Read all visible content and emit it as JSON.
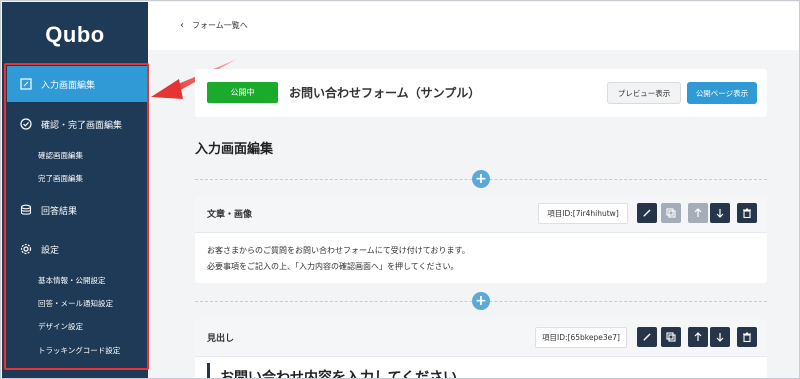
{
  "app": {
    "logo": "Qubo"
  },
  "sidebar": {
    "items": [
      {
        "label": "入力画面編集",
        "icon": "edit-icon",
        "active": true
      },
      {
        "label": "確認・完了画面編集",
        "icon": "check-circle-icon"
      },
      {
        "label": "回答結果",
        "icon": "database-icon"
      },
      {
        "label": "設定",
        "icon": "gear-icon"
      }
    ],
    "sub_confirm": [
      "確認画面編集",
      "完了画面編集"
    ],
    "sub_settings": [
      "基本情報・公開設定",
      "回答・メール通知設定",
      "デザイン設定",
      "トラッキングコード設定"
    ]
  },
  "topbar": {
    "back_label": "フォーム一覧へ"
  },
  "form": {
    "status": "公開中",
    "title": "お問い合わせフォーム（サンプル）",
    "preview_label": "プレビュー表示",
    "public_label": "公開ページ表示"
  },
  "section": {
    "title": "入力画面編集"
  },
  "items": [
    {
      "name": "文章・画像",
      "id_label": "項目ID:[7ir4hihutw]",
      "body": [
        "お客さまからのご質問をお問い合わせフォームにて受け付けております。",
        "必要事項をご記入の上、「入力内容の確認画面へ」を押してください。"
      ]
    },
    {
      "name": "見出し",
      "id_label": "項目ID:[65bkepe3e7]",
      "heading": "お問い合わせ内容を入力してください"
    }
  ],
  "colors": {
    "sidebar": "#1f3a57",
    "active": "#2f9ad6",
    "status": "#1caa2c",
    "highlight": "#e53434"
  }
}
